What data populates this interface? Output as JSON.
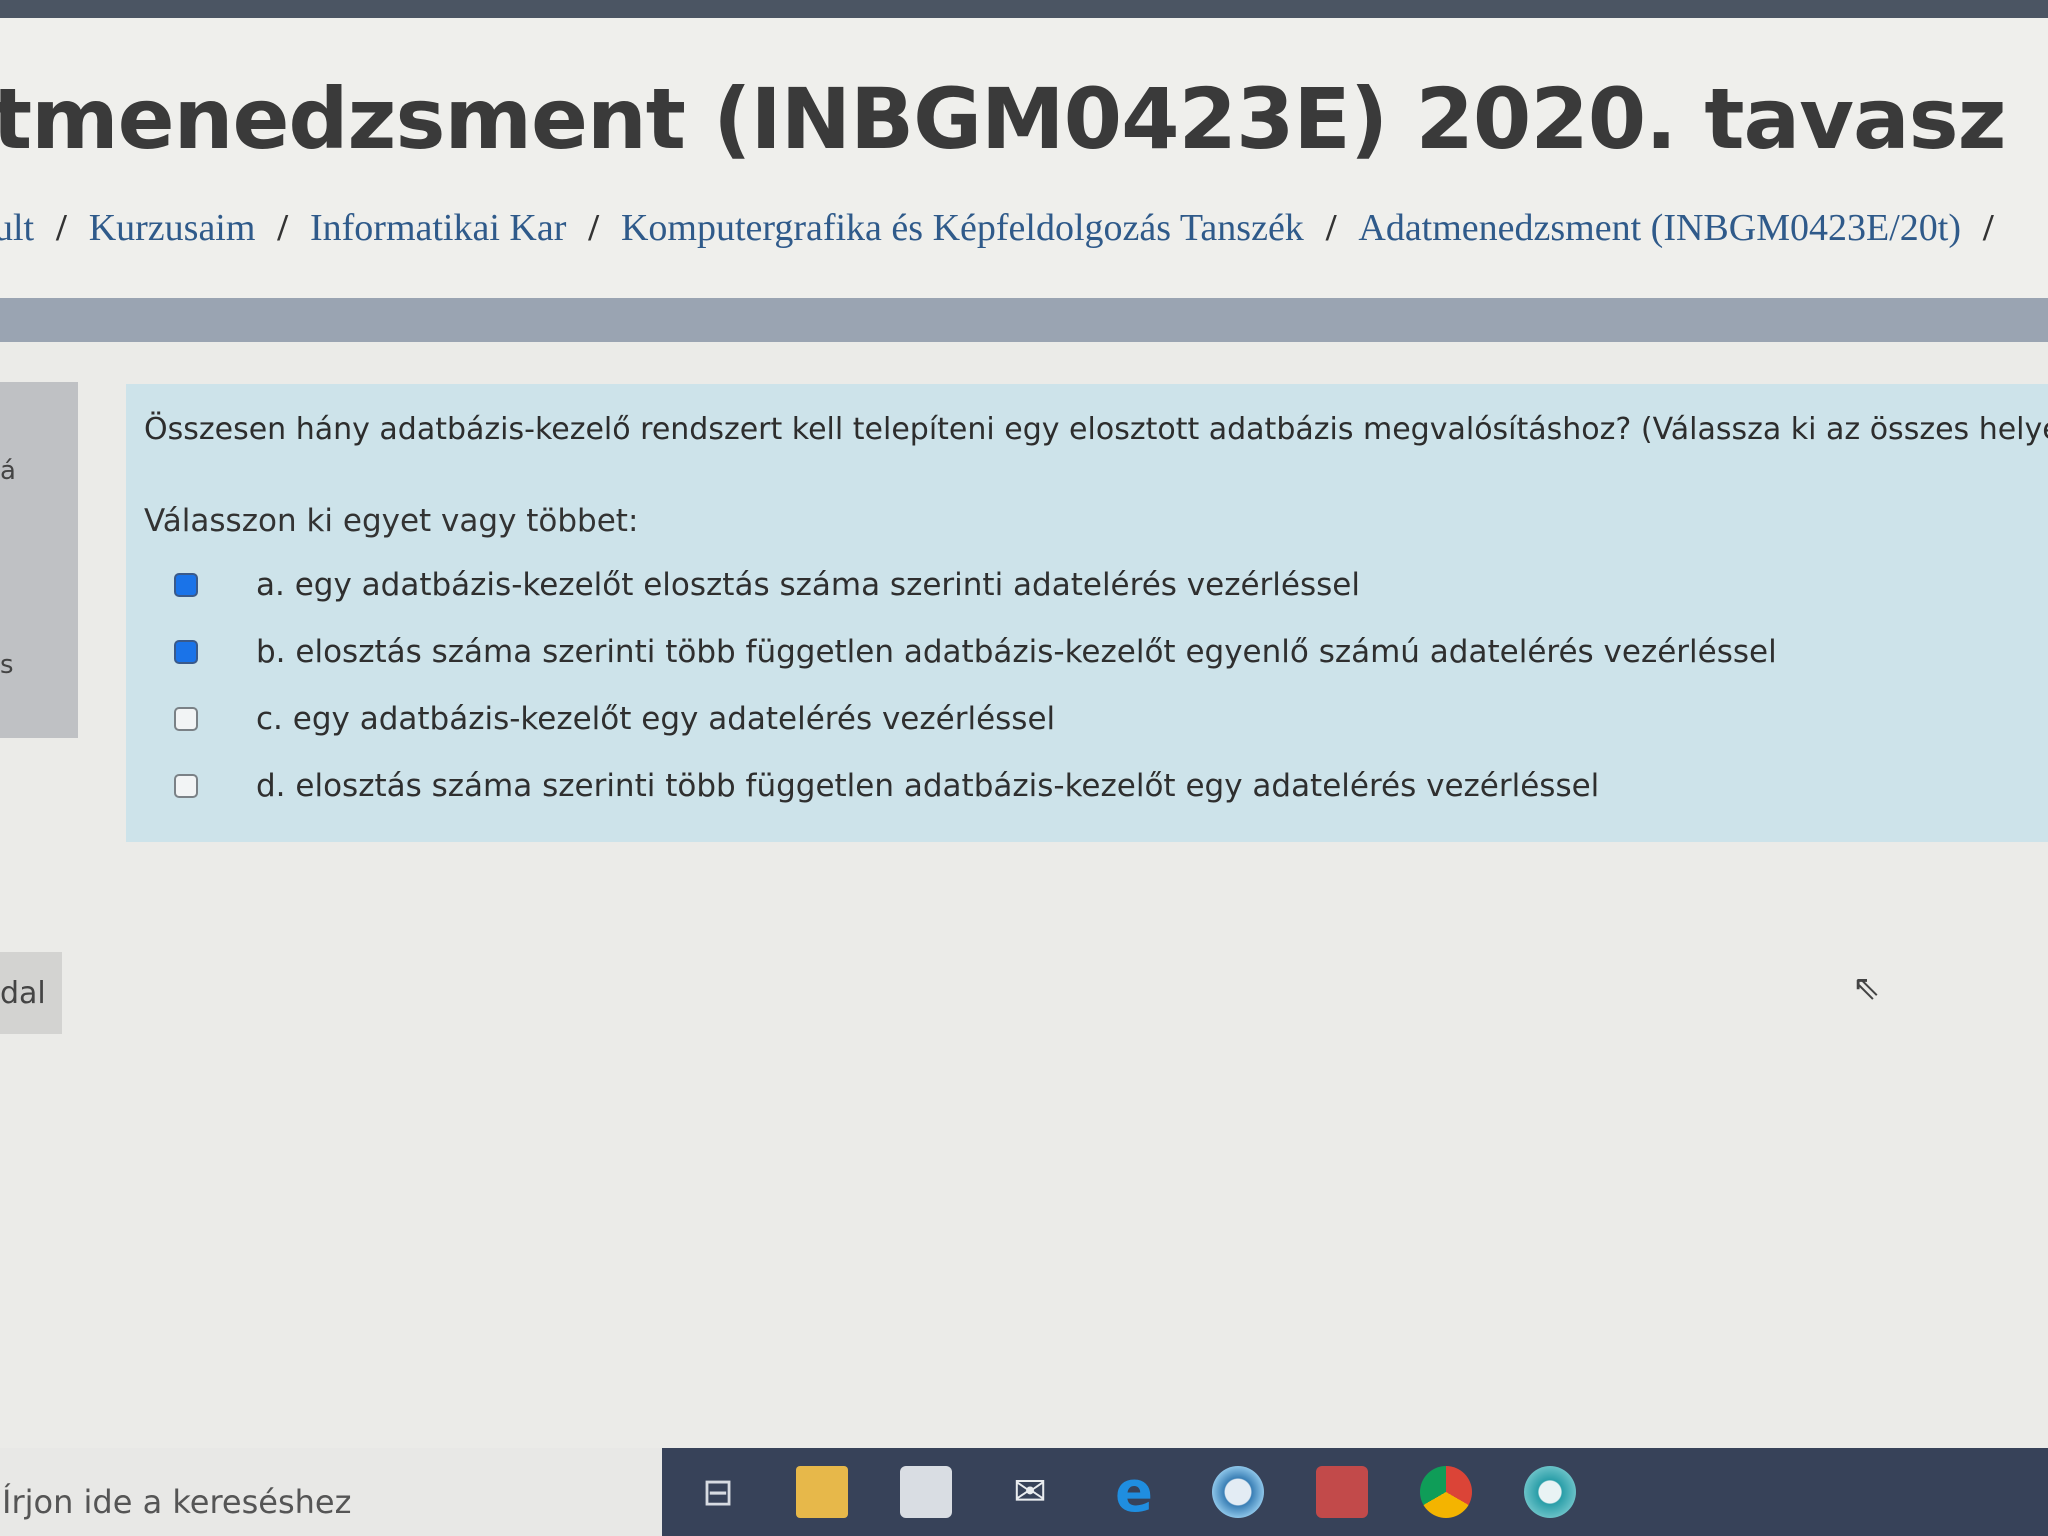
{
  "header": {
    "title": "tmenedzsment (INBGM0423E) 2020. tavasz",
    "breadcrumb": [
      "ult",
      "Kurzusaim",
      "Informatikai Kar",
      "Komputergrafika és Képfeldolgozás Tanszék",
      "Adatmenedzsment (INBGM0423E/20t)"
    ],
    "separator": "/"
  },
  "left_panel": {
    "fragment_1": "á",
    "fragment_2": "s",
    "button_fragment": "dal"
  },
  "question": {
    "text": "Összesen hány adatbázis-kezelő rendszert kell telepíteni egy elosztott adatbázis megvalósításhoz? (Válassza ki az összes helyeset!)",
    "prompt": "Válasszon ki egyet vagy többet:",
    "answers": [
      {
        "label": "a. egy adatbázis-kezelőt elosztás száma szerinti adatelérés vezérléssel",
        "checked": true
      },
      {
        "label": "b. elosztás száma szerinti több független adatbázis-kezelőt egyenlő számú adatelérés vezérléssel",
        "checked": true
      },
      {
        "label": "c. egy adatbázis-kezelőt egy adatelérés vezérléssel",
        "checked": false
      },
      {
        "label": "d. elosztás száma szerinti több független adatbázis-kezelőt egy adatelérés vezérléssel",
        "checked": false
      }
    ]
  },
  "taskbar": {
    "search_placeholder": "Írjon ide a kereséshez",
    "icons": [
      "task-view-icon",
      "file-explorer-icon",
      "store-icon",
      "mail-icon",
      "edge-icon",
      "app-circle-icon",
      "app-red-icon",
      "chrome-icon",
      "app-teal-icon"
    ]
  },
  "colors": {
    "accent": "#1a73e8",
    "link": "#2f5a8a",
    "question_bg": "#cde3ea",
    "taskbar": "#374259"
  }
}
